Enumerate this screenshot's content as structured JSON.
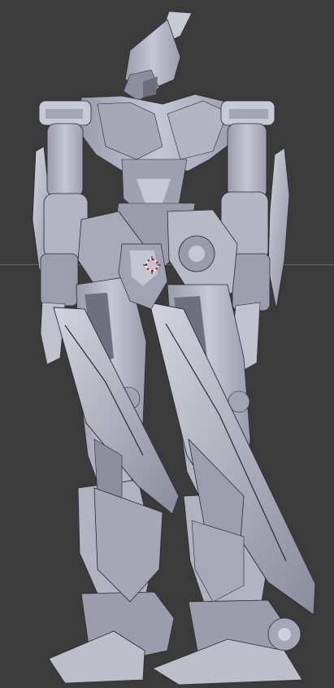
{
  "viewport": {
    "background_color": "#3b3b3b",
    "horizon_line_color": "#6a6a6a",
    "model_base_color": "#b7b7c6",
    "model_shadow_color": "#8d8d9e",
    "model_highlight_color": "#dadae3",
    "model_edge_color": "#2a2a33"
  },
  "cursor": {
    "icon": "3d-cursor-icon",
    "ring_color": "#c21f1f"
  }
}
